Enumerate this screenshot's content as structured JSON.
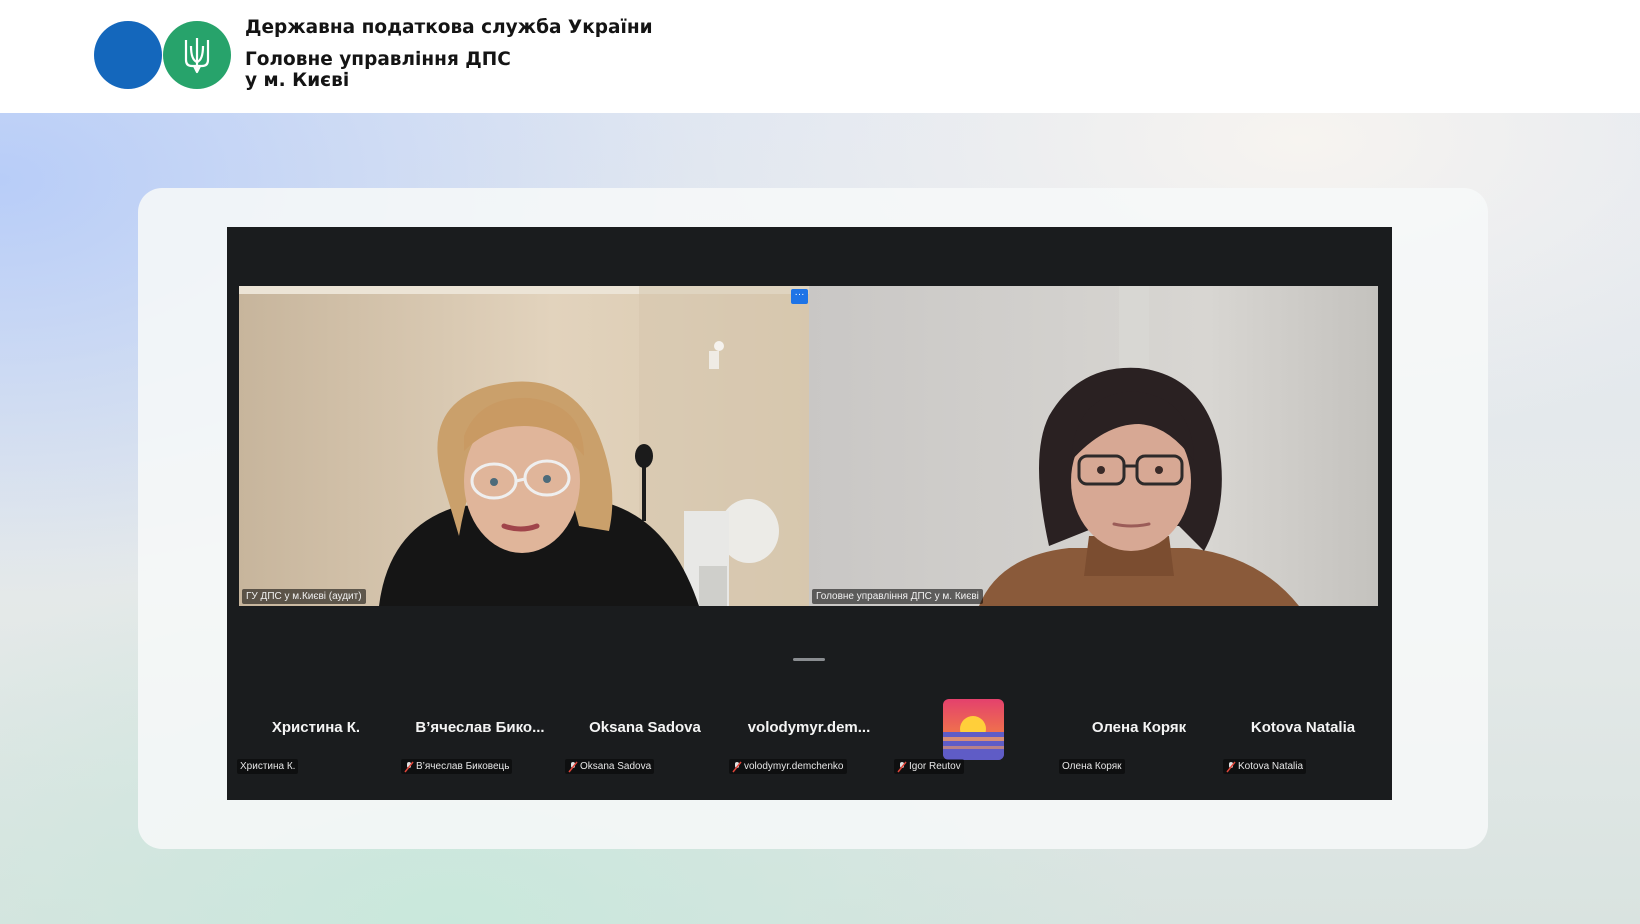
{
  "header": {
    "org_title": "Державна податкова служба України",
    "org_sub_line1": "Головне управління ДПС",
    "org_sub_line2": "у м. Києві"
  },
  "meeting": {
    "tiles": [
      {
        "name": "ГУ ДПС у м.Києві (аудит)"
      },
      {
        "name": "Головне управління ДПС у м. Києві",
        "active_speaker": true
      }
    ],
    "more_button_label": "···",
    "strip": [
      {
        "display": "Христина К.",
        "label": "Христина К.",
        "muted": false
      },
      {
        "display": "В’ячеслав  Бико...",
        "label": "В’ячеслав Биковець",
        "muted": true
      },
      {
        "display": "Oksana Sadova",
        "label": "Oksana Sadova",
        "muted": true
      },
      {
        "display": "volodymyr.dem...",
        "label": "volodymyr.demchenko",
        "muted": true
      },
      {
        "display": "",
        "label": "Igor Reutov",
        "muted": true,
        "avatar": "sunset-picture"
      },
      {
        "display": "Олена Коряк",
        "label": "Олена Коряк",
        "muted": false
      },
      {
        "display": "Kotova Natalia",
        "label": "Kotova Natalia",
        "muted": true
      }
    ]
  },
  "colors": {
    "accent_blue": "#1467bc",
    "accent_green": "#27a36b",
    "speaker_border": "#34d19a",
    "meeting_bg": "#1a1c1e"
  },
  "icons": [
    "trident-icon",
    "more-options-icon",
    "muted-mic-icon"
  ]
}
